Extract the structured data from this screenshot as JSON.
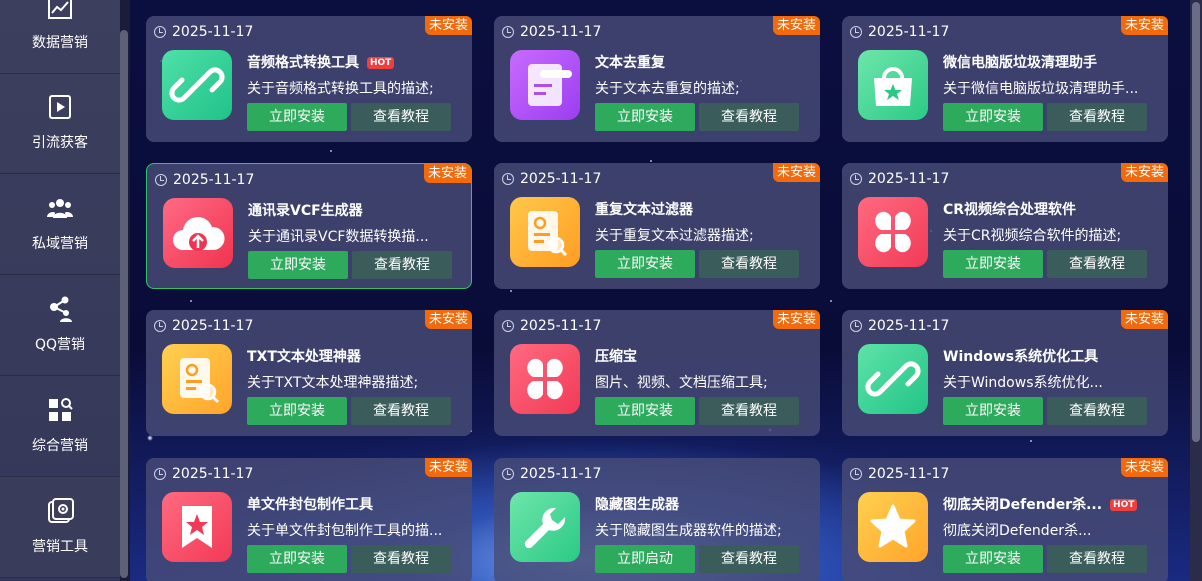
{
  "sidebar": {
    "items": [
      {
        "label": "数据营销",
        "icon": "chart-line-icon"
      },
      {
        "label": "引流获客",
        "icon": "video-play-icon"
      },
      {
        "label": "私域营销",
        "icon": "users-icon"
      },
      {
        "label": "QQ营销",
        "icon": "share-users-icon"
      },
      {
        "label": "综合营销",
        "icon": "grid-search-icon"
      },
      {
        "label": "营销工具",
        "icon": "toolbox-icon"
      }
    ]
  },
  "cards": [
    {
      "date": "2025-11-17",
      "badge": "未安装",
      "title": "音频格式转换工具",
      "hot": "HOT",
      "desc": "关于音频格式转换工具的描述;",
      "install": "立即安装",
      "tutorial": "查看教程",
      "icon": "link-icon",
      "color1": "#4fe0a8",
      "color2": "#1fc289"
    },
    {
      "date": "2025-11-17",
      "badge": "未安装",
      "title": "文本去重复",
      "hot": "",
      "desc": "关于文本去重复的描述;",
      "install": "立即安装",
      "tutorial": "查看教程",
      "icon": "document-icon",
      "color1": "#c86bff",
      "color2": "#9b3df0"
    },
    {
      "date": "2025-11-17",
      "badge": "未安装",
      "title": "微信电脑版垃圾清理助手",
      "hot": "",
      "desc": "关于微信电脑版垃圾清理助手...",
      "install": "立即安装",
      "tutorial": "查看教程",
      "icon": "shopping-bag-icon",
      "color1": "#6ee6ab",
      "color2": "#2bc985"
    },
    {
      "date": "2025-11-17",
      "badge": "未安装",
      "title": "通讯录VCF生成器",
      "hot": "",
      "desc": "关于通讯录VCF数据转换描...",
      "install": "立即安装",
      "tutorial": "查看教程",
      "icon": "cloud-upload-icon",
      "color1": "#ff6a85",
      "color2": "#f0344f"
    },
    {
      "date": "2025-11-17",
      "badge": "未安装",
      "title": "重复文本过滤器",
      "hot": "",
      "desc": "关于重复文本过滤器描述;",
      "install": "立即安装",
      "tutorial": "查看教程",
      "icon": "file-search-icon",
      "color1": "#ffc84a",
      "color2": "#ff9d23"
    },
    {
      "date": "2025-11-17",
      "badge": "未安装",
      "title": "CR视频综合处理软件",
      "hot": "",
      "desc": "关于CR视频综合软件的描述;",
      "install": "立即安装",
      "tutorial": "查看教程",
      "icon": "petals-icon",
      "color1": "#ff6a80",
      "color2": "#f23a57"
    },
    {
      "date": "2025-11-17",
      "badge": "未安装",
      "title": "TXT文本处理神器",
      "hot": "",
      "desc": "关于TXT文本处理神器描述;",
      "install": "立即安装",
      "tutorial": "查看教程",
      "icon": "file-search-icon",
      "color1": "#ffd050",
      "color2": "#ffa52a"
    },
    {
      "date": "2025-11-17",
      "badge": "未安装",
      "title": "压缩宝",
      "hot": "",
      "desc": "图片、视频、文档压缩工具;",
      "install": "立即安装",
      "tutorial": "查看教程",
      "icon": "petals-icon",
      "color1": "#ff6a80",
      "color2": "#f23a57"
    },
    {
      "date": "2025-11-17",
      "badge": "未安装",
      "title": "Windows系统优化工具",
      "hot": "",
      "desc": "关于Windows系统优化...",
      "install": "立即安装",
      "tutorial": "查看教程",
      "icon": "link-icon",
      "color1": "#5ee3a8",
      "color2": "#22c486"
    },
    {
      "date": "2025-11-17",
      "badge": "未安装",
      "title": "单文件封包制作工具",
      "hot": "",
      "desc": "关于单文件封包制作工具的描...",
      "install": "立即安装",
      "tutorial": "查看教程",
      "icon": "bookmark-star-icon",
      "color1": "#ff6a80",
      "color2": "#f23a57"
    },
    {
      "date": "2025-11-17",
      "badge": "",
      "title": "隐藏图生成器",
      "hot": "",
      "desc": "关于隐藏图生成器软件的描述;",
      "install": "立即启动",
      "tutorial": "查看教程",
      "icon": "wrench-icon",
      "color1": "#6ee6ab",
      "color2": "#2bc985"
    },
    {
      "date": "2025-11-17",
      "badge": "未安装",
      "title": "彻底关闭Defender杀...",
      "hot": "HOT",
      "desc": "彻底关闭Defender杀...",
      "install": "立即安装",
      "tutorial": "查看教程",
      "icon": "star-icon",
      "color1": "#ffd050",
      "color2": "#ffa52a"
    }
  ]
}
